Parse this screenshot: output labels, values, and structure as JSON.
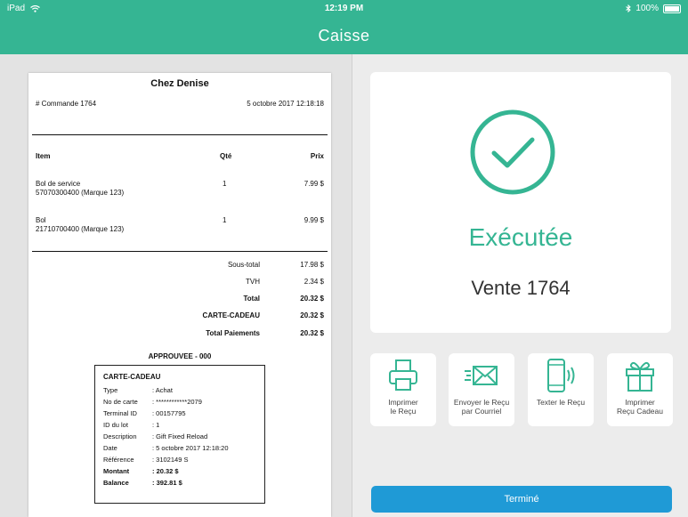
{
  "status_bar": {
    "device": "iPad",
    "time": "12:19 PM",
    "battery": "100%"
  },
  "nav": {
    "title": "Caisse"
  },
  "receipt": {
    "store_name": "Chez Denise",
    "order_label": "# Commande 1764",
    "date": "5 octobre 2017 12:18:18",
    "columns": {
      "item": "Item",
      "qty": "Qté",
      "price": "Prix"
    },
    "items": [
      {
        "name": "Bol de service",
        "sku": "57070300400 (Marque 123)",
        "qty": "1",
        "price": "7.99 $"
      },
      {
        "name": "Bol",
        "sku": "21710700400 (Marque 123)",
        "qty": "1",
        "price": "9.99 $"
      }
    ],
    "totals": [
      {
        "label": "Sous-total",
        "value": "17.98 $",
        "bold": false
      },
      {
        "label": "TVH",
        "value": "2.34 $",
        "bold": false
      },
      {
        "label": "Total",
        "value": "20.32 $",
        "bold": true
      },
      {
        "label": "CARTE-CADEAU",
        "value": "20.32 $",
        "bold": true
      },
      {
        "label": "Total Paiements",
        "value": "20.32 $",
        "bold": true
      }
    ],
    "approved": "APPROUVEE - 000",
    "slip": {
      "title": "CARTE-CADEAU",
      "rows": [
        {
          "k": "Type",
          "v": ": Achat",
          "bold": false
        },
        {
          "k": "No de carte",
          "v": ": ************2079",
          "bold": false
        },
        {
          "k": "Terminal ID",
          "v": ": 00157795",
          "bold": false
        },
        {
          "k": "ID du lot",
          "v": ": 1",
          "bold": false
        },
        {
          "k": "Description",
          "v": ": Gift Fixed Reload",
          "bold": false
        },
        {
          "k": "Date",
          "v": ": 5 octobre 2017 12:18:20",
          "bold": false
        },
        {
          "k": "Référence",
          "v": ": 3102149 S",
          "bold": false
        },
        {
          "k": "Montant",
          "v": ": 20.32 $",
          "bold": true
        },
        {
          "k": "Balance",
          "v": ": 392.81 $",
          "bold": true
        }
      ]
    }
  },
  "result": {
    "status": "Exécutée",
    "sale": "Vente 1764"
  },
  "actions": [
    {
      "label": "Imprimer\nle Reçu",
      "icon": "printer-icon"
    },
    {
      "label": "Envoyer le Reçu\npar Courriel",
      "icon": "envelope-icon"
    },
    {
      "label": "Texter le Reçu",
      "icon": "phone-icon"
    },
    {
      "label": "Imprimer\nReçu Cadeau",
      "icon": "gift-icon"
    }
  ],
  "done_label": "Terminé",
  "colors": {
    "brand": "#35b593",
    "primary_button": "#1f9ad6"
  }
}
